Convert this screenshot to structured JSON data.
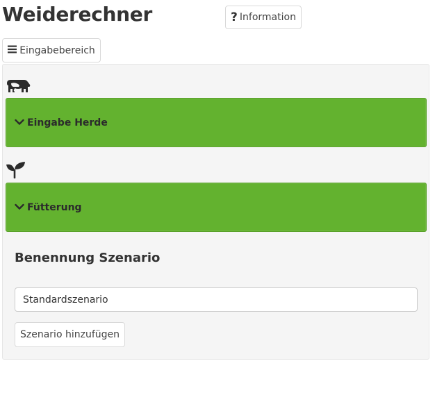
{
  "header": {
    "title": "Weiderechner",
    "info_button": {
      "icon": "question-icon",
      "label": "Information"
    }
  },
  "sidebar_toggle": {
    "icon": "bars-icon",
    "label": "Eingabebereich"
  },
  "sections": [
    {
      "icon": "cow-icon",
      "label": "Eingabe Herde",
      "chevron": "chevron-down-icon"
    },
    {
      "icon": "seedling-icon",
      "label": "Fütterung",
      "chevron": "chevron-down-icon"
    }
  ],
  "scenario": {
    "title": "Benennung Szenario",
    "input_value": "Standardszenario",
    "add_button_label": "Szenario hinzufügen"
  },
  "colors": {
    "accordion_green": "#63b22f",
    "panel_bg": "#f5f5f5",
    "text": "#333333"
  }
}
